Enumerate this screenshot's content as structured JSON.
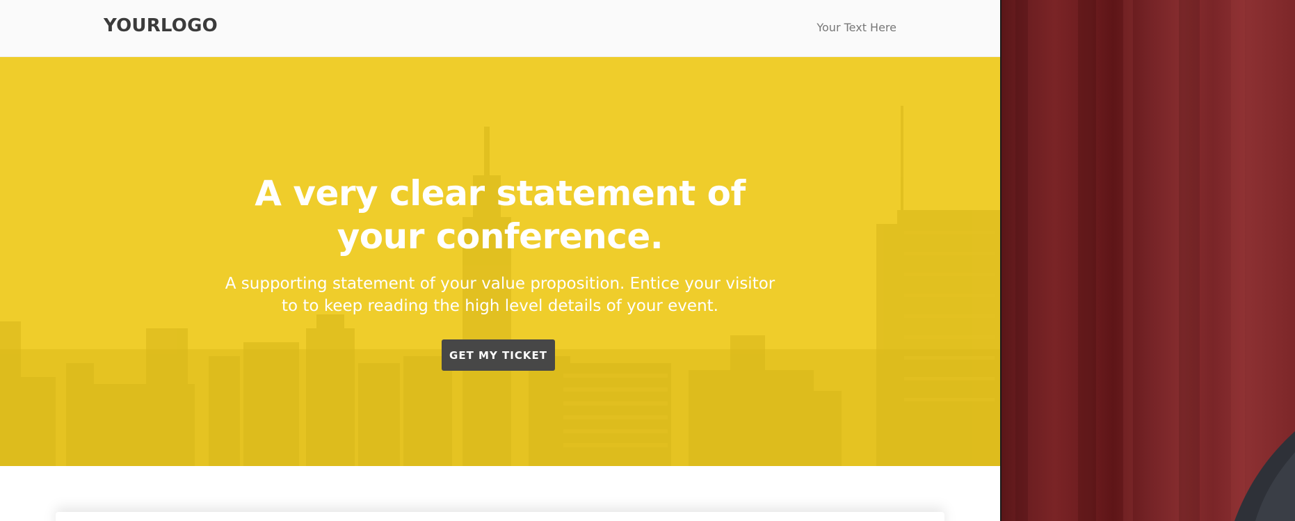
{
  "navbar": {
    "logo": "YOURLOGO",
    "link": "Your Text Here"
  },
  "hero": {
    "headline": "A very clear statement of your conference.",
    "subheadline": "A supporting statement of your value proposition. Entice your visitor to to keep reading the high level details of your event.",
    "cta_label": "GET MY TICKET",
    "colors": {
      "overlay": "#efcd2b",
      "button": "#474747",
      "text": "#ffffff"
    }
  },
  "side_photo": {
    "colors": {
      "curtain": "#7a2426",
      "shoulder": "#2e3138"
    }
  }
}
